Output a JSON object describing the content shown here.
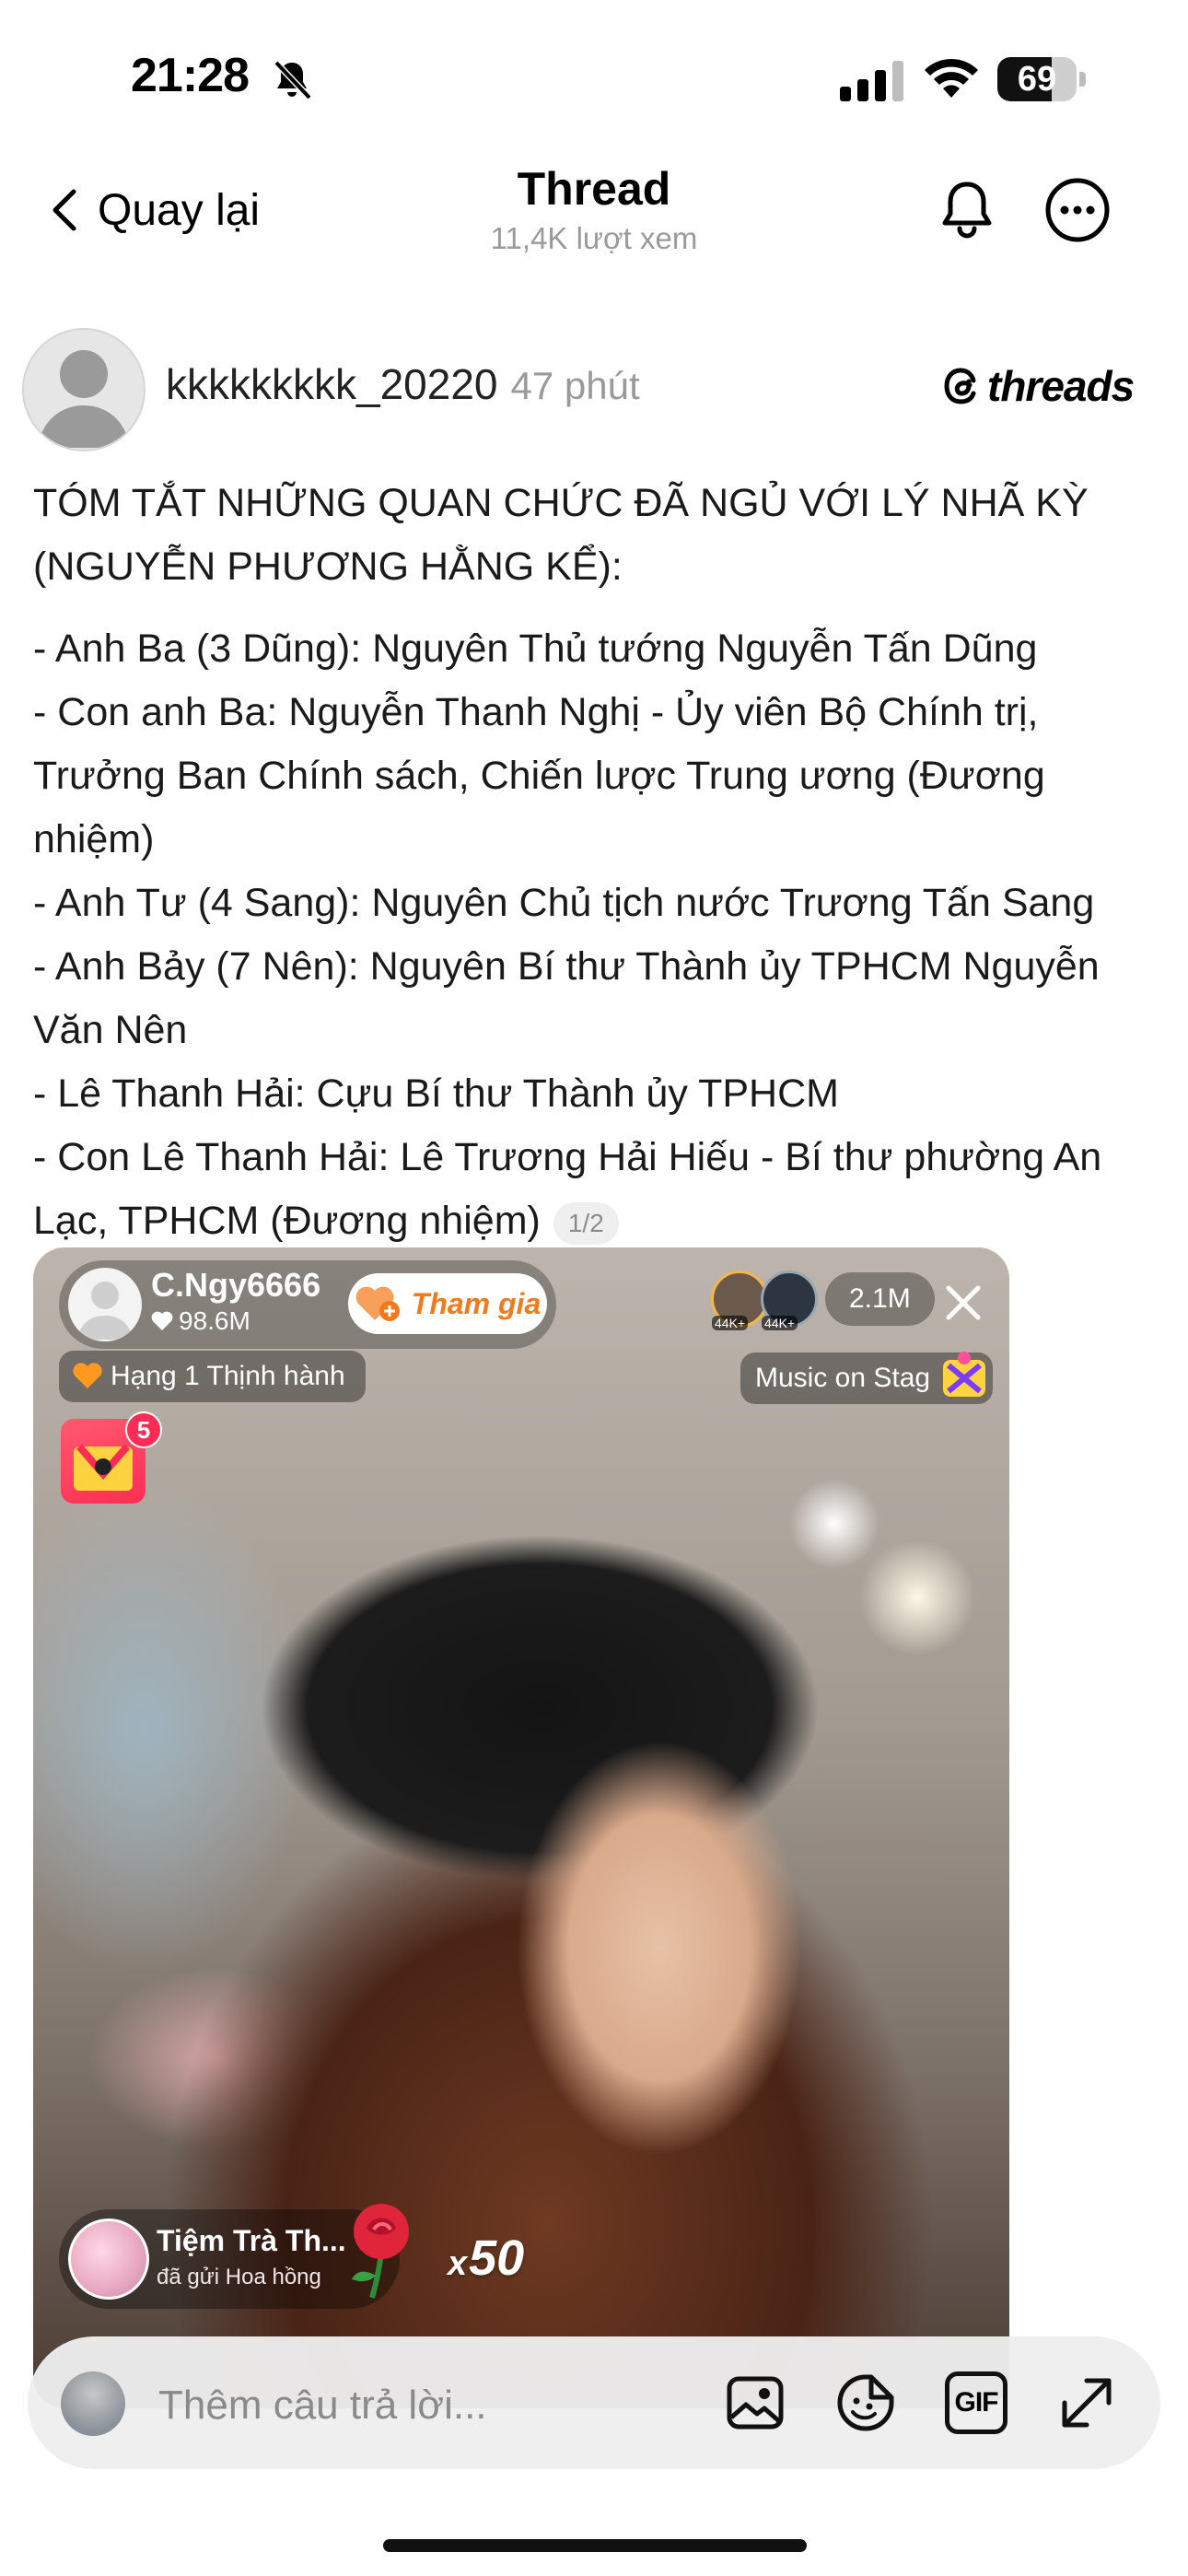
{
  "status_bar": {
    "time": "21:28",
    "battery": "69",
    "battery_level": 0.69
  },
  "header": {
    "back_label": "Quay lại",
    "title": "Thread",
    "subtitle": "11,4K lượt xem",
    "icons": [
      "bell-icon",
      "more-icon"
    ]
  },
  "post": {
    "author": "kkkkkkkkk_20220",
    "time": "47 phút",
    "brand": "threads",
    "title_lines": [
      "TÓM TẮT NHỮNG QUAN CHỨC ĐÃ NGỦ VỚI LÝ NHÃ KỲ",
      "(NGUYỄN PHƯƠNG HẰNG KỂ):"
    ],
    "items": [
      "- Anh Ba (3 Dũng): Nguyên Thủ tướng Nguyễn Tấn Dũng",
      "- Con anh Ba: Nguyễn Thanh Nghị - Ủy viên Bộ Chính trị, Trưởng Ban Chính sách, Chiến lược Trung ương (Đương nhiệm)",
      "- Anh Tư (4 Sang): Nguyên Chủ tịch nước Trương Tấn Sang",
      "- Anh Bảy (7 Nên): Nguyên Bí thư Thành ủy TPHCM Nguyễn Văn Nên",
      "- Lê Thanh Hải: Cựu Bí thư Thành ủy TPHCM",
      "- Con Lê Thanh Hải: Lê Trương Hải Hiếu - Bí thư phường An Lạc, TPHCM (Đương nhiệm)"
    ],
    "page_indicator": "1/2"
  },
  "media": {
    "host_name": "C.Ngy6666",
    "host_likes": "98.6M",
    "follow_label": "Tham gia",
    "viewer_badges": [
      "44K+",
      "44K+"
    ],
    "viewer_count": "2.1M",
    "rank_label": "Hạng 1 Thịnh hành",
    "music_label": "Music on Stag",
    "gift_badge": "5",
    "gift_sender": "Tiệm Trà Th...",
    "gift_action": "đã gửi Hoa hồng",
    "gift_count": "50",
    "gift_count_prefix": "x"
  },
  "reply": {
    "placeholder": "Thêm câu trả lời...",
    "gif_label": "GIF",
    "icons": [
      "image-icon",
      "sticker-icon",
      "gif-icon",
      "expand-icon"
    ]
  }
}
